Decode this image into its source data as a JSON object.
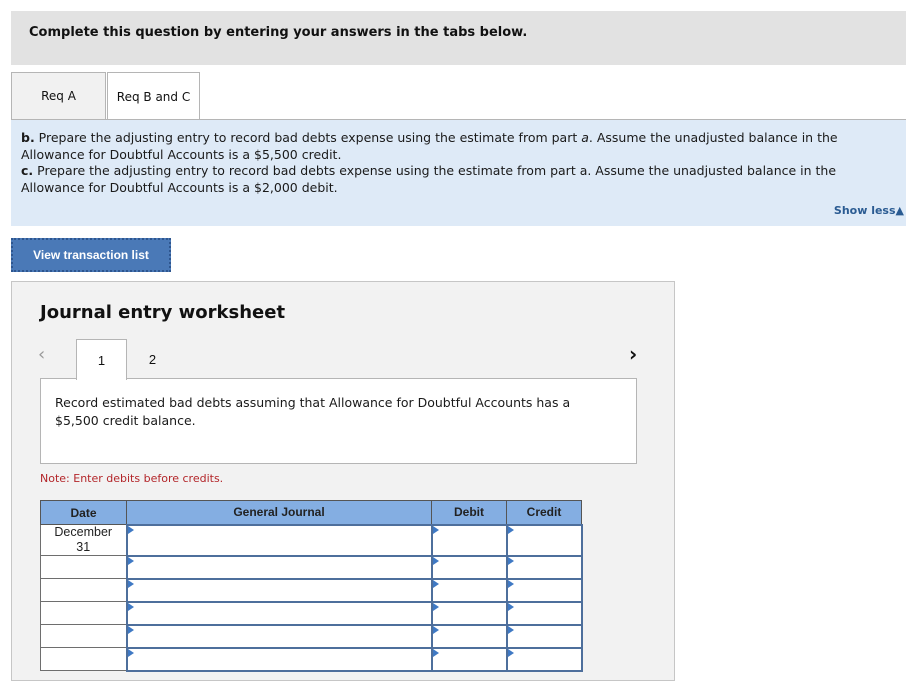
{
  "header": {
    "title": "Complete this question by entering your answers in the tabs below."
  },
  "tabs": [
    {
      "label": "Req A",
      "active": false
    },
    {
      "label": "Req B and C",
      "active": true
    }
  ],
  "requirements": {
    "b_label": "b.",
    "b_text": " Prepare the adjusting entry to record bad debts expense using the estimate from part ",
    "b_italic": "a",
    "b_text2": ". Assume the unadjusted balance in the Allowance for Doubtful Accounts is a $5,500 credit.",
    "c_label": "c.",
    "c_text": " Prepare the adjusting entry to record bad debts expense using the estimate from part a. Assume the unadjusted balance in the Allowance for Doubtful Accounts is a $2,000 debit.",
    "show_less": "Show less",
    "show_less_icon": "▲"
  },
  "view_transaction_button": "View transaction list",
  "worksheet": {
    "title": "Journal entry worksheet",
    "prev_icon": "‹",
    "next_icon": "›",
    "entry_tabs": [
      "1",
      "2"
    ],
    "active_entry": "1",
    "description": "Record estimated bad debts assuming that Allowance for Doubtful Accounts has a $5,500 credit balance.",
    "note": "Note: Enter debits before credits.",
    "table": {
      "headers": {
        "date": "Date",
        "general_journal": "General Journal",
        "debit": "Debit",
        "credit": "Credit"
      },
      "rows": [
        {
          "date_line1": "December",
          "date_line2": "31",
          "account": "",
          "debit": "",
          "credit": ""
        },
        {
          "date_line1": "",
          "date_line2": "",
          "account": "",
          "debit": "",
          "credit": ""
        },
        {
          "date_line1": "",
          "date_line2": "",
          "account": "",
          "debit": "",
          "credit": ""
        },
        {
          "date_line1": "",
          "date_line2": "",
          "account": "",
          "debit": "",
          "credit": ""
        },
        {
          "date_line1": "",
          "date_line2": "",
          "account": "",
          "debit": "",
          "credit": ""
        },
        {
          "date_line1": "",
          "date_line2": "",
          "account": "",
          "debit": "",
          "credit": ""
        }
      ]
    }
  }
}
